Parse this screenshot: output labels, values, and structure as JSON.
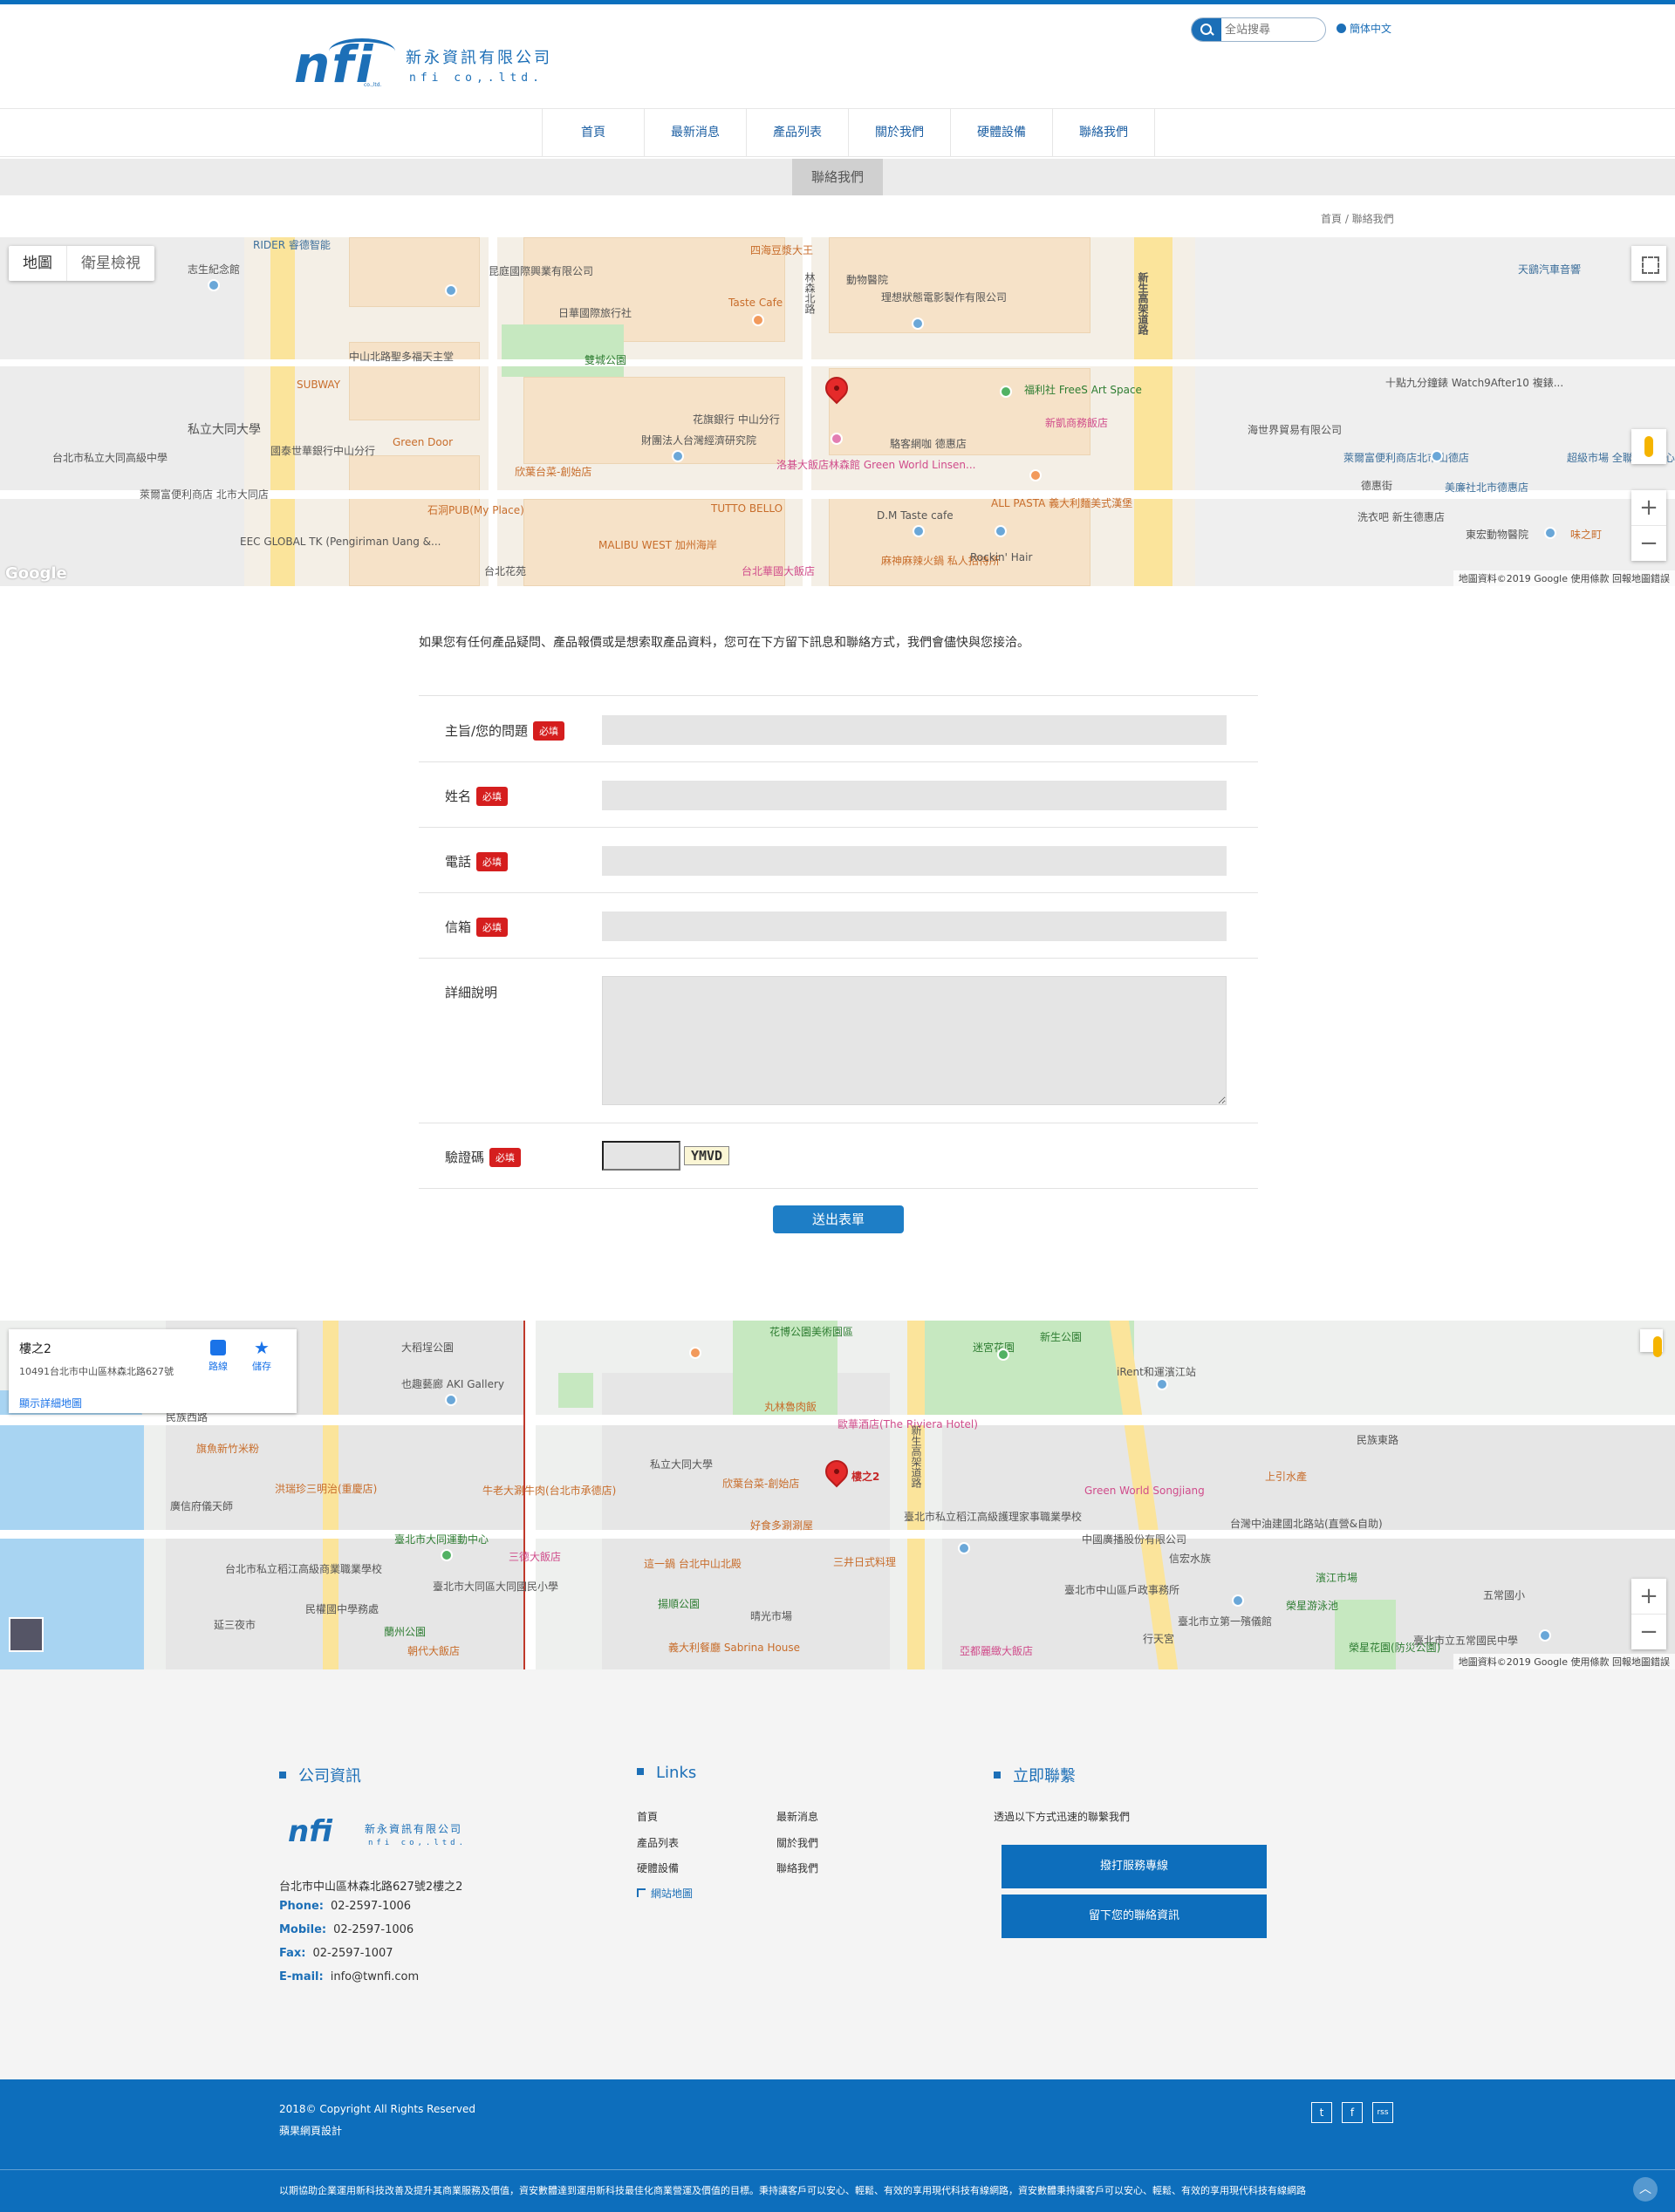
{
  "header": {
    "logo_mark": "nfi",
    "logo_co": "co.,ltd.",
    "company_cn": "新永資訊有限公司",
    "company_en": "nfi co,.ltd.",
    "search_placeholder": "全站搜尋",
    "language": "簡体中文"
  },
  "nav": {
    "items": [
      "首頁",
      "最新消息",
      "產品列表",
      "關於我們",
      "硬體設備",
      "聯絡我們"
    ]
  },
  "subheader": {
    "tab": "聯絡我們"
  },
  "breadcrumb": "首頁 / 聯絡我們",
  "map_top": {
    "view_map": "地圖",
    "view_satellite": "衛星檢視",
    "zoom_in": "+",
    "zoom_out": "−",
    "google": "Google",
    "attribution": "地圖資料©2019 Google   使用條款   回報地圖錯誤",
    "labels": [
      "昆庭國際興業有限公司",
      "四海豆漿大王",
      "動物醫院",
      "理想狀態電影製作有限公司",
      "天鷂汽車音響",
      "志生紀念館",
      "RIDER 睿德智能",
      "日華國際旅行社",
      "Taste Cafe",
      "雙城公園",
      "中山北路聖多福天主堂",
      "SUBWAY",
      "私立大同大學",
      "台北市私立大同高級中學",
      "國泰世華銀行中山分行",
      "Green Door",
      "財團法人台灣經濟研究院",
      "花旗銀行 中山分行",
      "洛碁大飯店林森館 Green World Linsen...",
      "駱客網咖 德惠店",
      "福利社 FreeS Art Space",
      "新凱商務飯店",
      "十點九分鐘錶 Watch9After10 複錶...",
      "海世界貿易有限公司",
      "萊爾富便利商店北市山德店",
      "超級市場 全聯福利中心",
      "美廉社北市德惠店",
      "欣葉台菜-創始店",
      "石洞PUB(My Place)",
      "TUTTO BELLO",
      "D.M Taste cafe",
      "ALL PASTA 義大利麵美式漢堡",
      "EEC GLOBAL TK (Pengiriman Uang &...",
      "MALIBU WEST 加州海岸",
      "台北花苑",
      "台北華國大飯店",
      "麻神麻辣火鍋 私人招待所",
      "Rockin' Hair",
      "洗衣吧 新生德惠店",
      "東宏動物醫院",
      "味之町",
      "新生高架道路",
      "林森北路",
      "萊爾富便利商店 北市大同店",
      "德惠街"
    ]
  },
  "intro_text": "如果您有任何產品疑問、產品報價或是想索取產品資料，您可在下方留下訊息和聯絡方式，我們會儘快與您接洽。",
  "form": {
    "required_badge": "必填",
    "fields": [
      {
        "label": "主旨/您的問題",
        "required": true
      },
      {
        "label": "姓名",
        "required": true
      },
      {
        "label": "電話",
        "required": true
      },
      {
        "label": "信箱",
        "required": true
      },
      {
        "label": "詳細說明",
        "required": false
      },
      {
        "label": "驗證碼",
        "required": true
      }
    ],
    "captcha_code": "YMVD",
    "submit": "送出表單"
  },
  "map_bottom": {
    "place_title": "樓之2",
    "place_address": "10491台北市中山區林森北路627號",
    "directions": "路線",
    "save": "儲存",
    "larger_map": "顯示詳細地圖",
    "pin_label": "樓之2",
    "zoom_in": "+",
    "zoom_out": "−",
    "attribution": "地圖資料©2019 Google   使用條款   回報地圖錯誤",
    "labels": [
      "大稻埕公園",
      "也趣藝廊 AKI Gallery",
      "民族西路",
      "旗魚新竹米粉",
      "洪瑞珍三明治(重慶店)",
      "牛老大涮牛肉(台北市承德店)",
      "廣信府儀天師",
      "台北市私立稻江高級商業職業學校",
      "民權國中學務處",
      "延三夜市",
      "蘭州公園",
      "朝代大飯店",
      "臺北市大同運動中心",
      "三德大飯店",
      "臺北市大同區大同國民小學",
      "花博公園美術園區",
      "丸林魯肉飯",
      "歐華酒店(The Riviera Hotel)",
      "私立大同大學",
      "欣葉台菜-創始店",
      "好食多涮涮屋",
      "三井日式料理",
      "這一鍋 台北中山北殿",
      "揚順公園",
      "晴光市場",
      "義大利餐廳 Sabrina House",
      "新生公園",
      "臺北市私立稻江高級護理家事職業學校",
      "iRent和運濱江站",
      "Green World Songjiang",
      "上引水產",
      "中國廣播股份有限公司",
      "信宏水族",
      "臺北市中山區戶政事務所",
      "濱江市場",
      "榮星游泳池",
      "五常國小",
      "臺北市立第一殯儀館",
      "臺北市立五常國民中學",
      "榮星花園(防災公園)",
      "台灣中油建國北路站(直營&自助)",
      "行天宮",
      "亞都麗緻大飯店",
      "新生高架道路",
      "民族東路",
      "迷宮花園"
    ]
  },
  "footer": {
    "col1_title": "公司資訊",
    "col2_title": "Links",
    "col3_title": "立即聯繫",
    "address": "台北市中山區林森北路627號2樓之2",
    "contacts": [
      {
        "label": "Phone:",
        "value": "02-2597-1006"
      },
      {
        "label": "Mobile:",
        "value": "02-2597-1006"
      },
      {
        "label": "Fax:",
        "value": "02-2597-1007"
      },
      {
        "label": "E-mail:",
        "value": "info@twnfi.com"
      }
    ],
    "links": [
      "首頁",
      "最新消息",
      "產品列表",
      "關於我們",
      "硬體設備",
      "聯絡我們"
    ],
    "sitemap": "網站地圖",
    "contact_desc": "透過以下方式迅速的聯繫我們",
    "btn_call": "撥打服務專線",
    "btn_leave": "留下您的聯絡資訊"
  },
  "bottom": {
    "copyright": "2018© Copyright All Rights Reserved",
    "designer": "蘋果網頁設計",
    "motto": "以期協助企業運用新科技改善及提升其商業服務及價值，資安數體達到運用新科技最佳化商業營運及價值的目標。秉持讓客戶可以安心、輕鬆、有效的享用現代科技有線網路，資安數體秉持讓客戶可以安心、輕鬆、有效的享用現代科技有線網路",
    "social": [
      "t",
      "f",
      "rss"
    ],
    "to_top": "︿"
  }
}
